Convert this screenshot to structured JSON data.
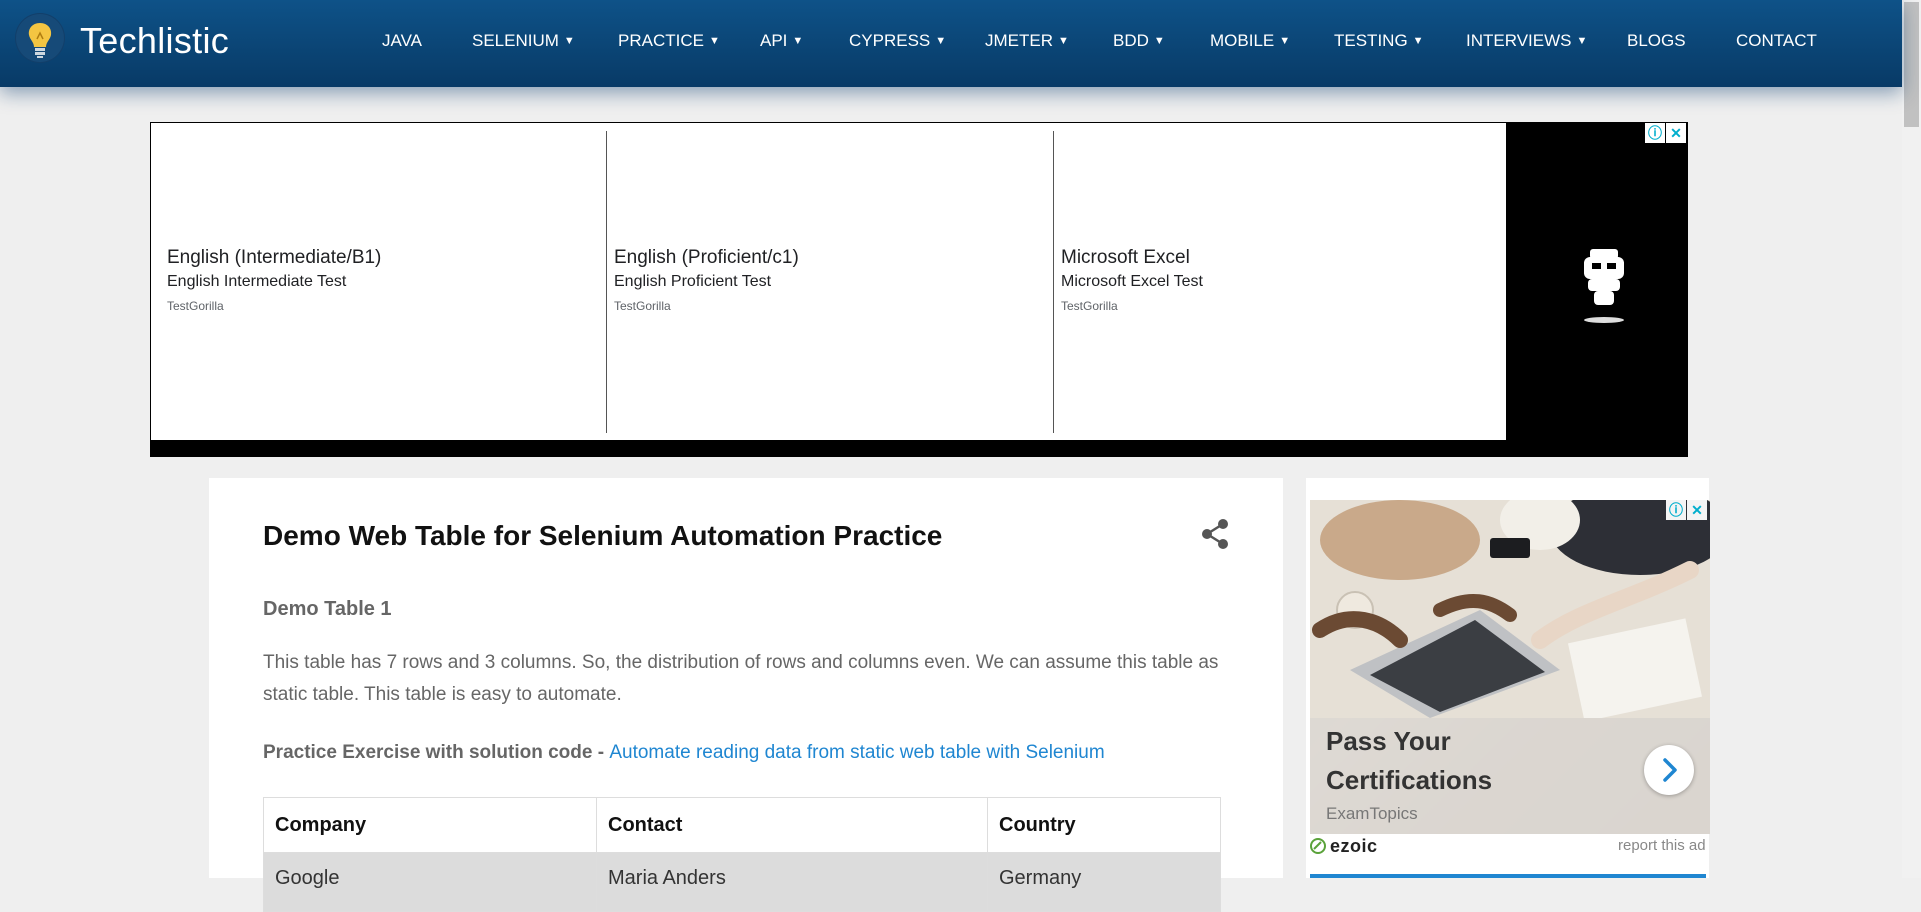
{
  "header": {
    "site_name": "Techlistic",
    "nav": [
      {
        "label": "JAVA",
        "caret": false
      },
      {
        "label": "SELENIUM",
        "caret": true
      },
      {
        "label": "PRACTICE",
        "caret": true
      },
      {
        "label": "API",
        "caret": true
      },
      {
        "label": "CYPRESS",
        "caret": true
      },
      {
        "label": "JMETER",
        "caret": true
      },
      {
        "label": "BDD",
        "caret": true
      },
      {
        "label": "MOBILE",
        "caret": true
      },
      {
        "label": "TESTING",
        "caret": true
      },
      {
        "label": "INTERVIEWS",
        "caret": true
      },
      {
        "label": "BLOGS",
        "caret": false
      },
      {
        "label": "CONTACT",
        "caret": false
      }
    ]
  },
  "top_ad": {
    "items": [
      {
        "title": "English (Intermediate/B1)",
        "subtitle": "English Intermediate Test",
        "source": "TestGorilla"
      },
      {
        "title": "English (Proficient/c1)",
        "subtitle": "English Proficient Test",
        "source": "TestGorilla"
      },
      {
        "title": "Microsoft Excel",
        "subtitle": "Microsoft Excel Test",
        "source": "TestGorilla"
      }
    ]
  },
  "main": {
    "page_title": "Demo Web Table for Selenium Automation Practice",
    "section_title": "Demo Table 1",
    "description": "This table has 7 rows and 3 columns. So, the distribution of rows and columns even. We can assume this table as static table. This table is easy to automate.",
    "practice_label": "Practice Exercise with solution code - ",
    "practice_link": "Automate reading data from static web table with Selenium",
    "table": {
      "headers": [
        "Company",
        "Contact",
        "Country"
      ],
      "rows": [
        [
          "Google",
          "Maria Anders",
          "Germany"
        ]
      ]
    }
  },
  "side_ad": {
    "headline": "Pass Your Certifications",
    "source": "ExamTopics",
    "brand": "ezoic",
    "report_link": "report this ad"
  },
  "colors": {
    "header_bg": "#0a4677",
    "link": "#1f86d1",
    "page_bg": "#efefef"
  }
}
